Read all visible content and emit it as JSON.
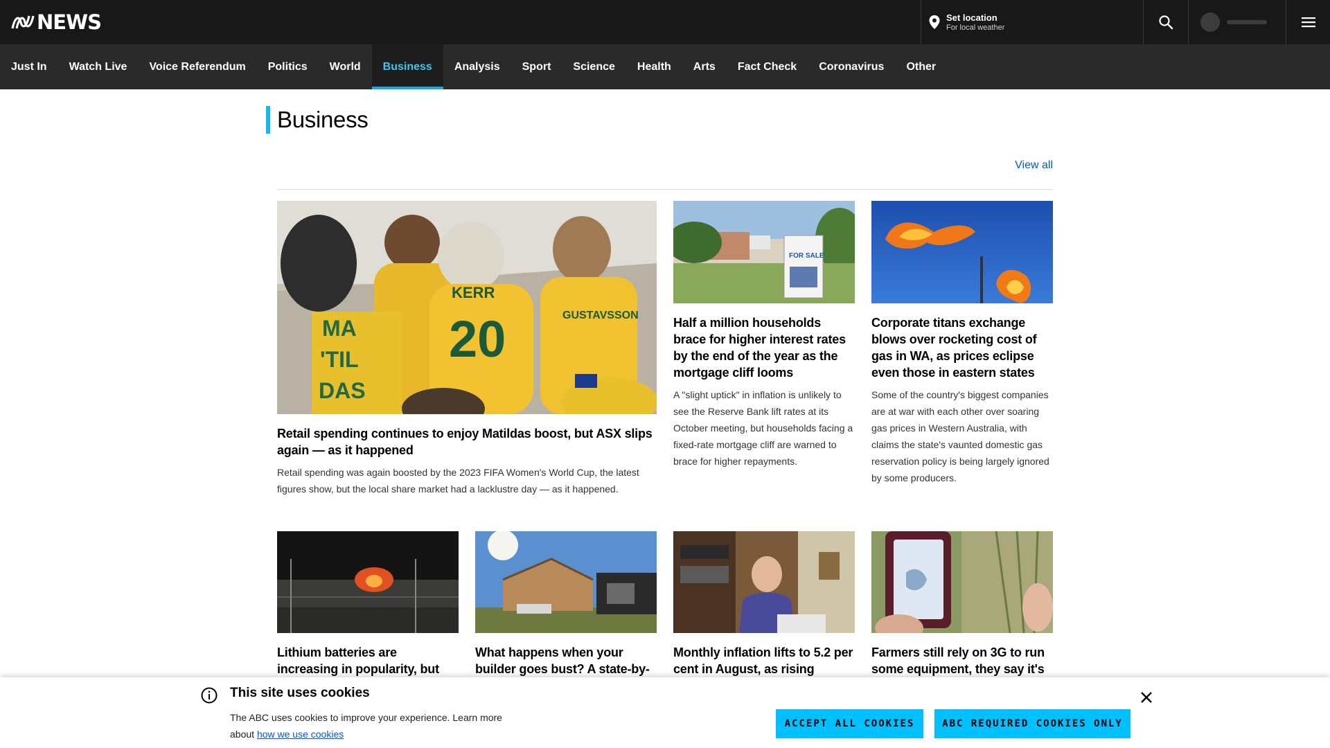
{
  "header": {
    "logo_text": "NEWS",
    "location_title": "Set location",
    "location_subtitle": "For local weather"
  },
  "nav": {
    "items": [
      "Just In",
      "Watch Live",
      "Voice Referendum",
      "Politics",
      "World",
      "Business",
      "Analysis",
      "Sport",
      "Science",
      "Health",
      "Arts",
      "Fact Check",
      "Coronavirus",
      "Other"
    ],
    "active": "Business"
  },
  "section": {
    "title": "Business",
    "view_all": "View all"
  },
  "stories": [
    {
      "headline": "Retail spending continues to enjoy Matildas boost, but ASX slips again — as it happened",
      "summary": "Retail spending was again boosted by the 2023 FIFA Women's World Cup, the latest figures show, but the local share market had a lacklustre day — as it happened.",
      "image": "fans-in-matildas-jerseys"
    },
    {
      "headline": "Half a million households brace for higher interest rates by the end of the year as the mortgage cliff looms",
      "summary": "A \"slight uptick\" in inflation is unlikely to see the Reserve Bank lift rates at its October meeting, but households facing a fixed-rate mortgage cliff are warned to brace for higher repayments.",
      "image": "for-sale-sign-house"
    },
    {
      "headline": "Corporate titans exchange blows over rocketing cost of gas in WA, as prices eclipse even those in eastern states",
      "summary": "Some of the country's biggest companies are at war with each other over soaring gas prices in Western Australia, with claims the state's vaunted domestic gas reservation policy is being largely ignored by some producers.",
      "image": "gas-flares-blue-sky"
    },
    {
      "headline": "Lithium batteries are increasing in popularity, but",
      "image": "fire-at-night-fence"
    },
    {
      "headline": "What happens when your builder goes bust? A state-by-",
      "image": "house-construction-frame"
    },
    {
      "headline": "Monthly inflation lifts to 5.2 per cent in August, as rising",
      "image": "man-at-desk"
    },
    {
      "headline": "Farmers still rely on 3G to run some equipment, they say it's",
      "image": "phone-in-hand-crops"
    }
  ],
  "cookie_banner": {
    "title": "This site uses cookies",
    "text": "The ABC uses cookies to improve your experience. Learn more about",
    "link": "how we use cookies",
    "accept_all": "ACCEPT ALL COOKIES",
    "required_only": "ABC REQUIRED COOKIES ONLY"
  },
  "colors": {
    "topbar": "#181818",
    "nav": "#2a2a2a",
    "accent": "#16b8ee",
    "link": "#0058cc",
    "cookie_button": "#00c0ff"
  }
}
